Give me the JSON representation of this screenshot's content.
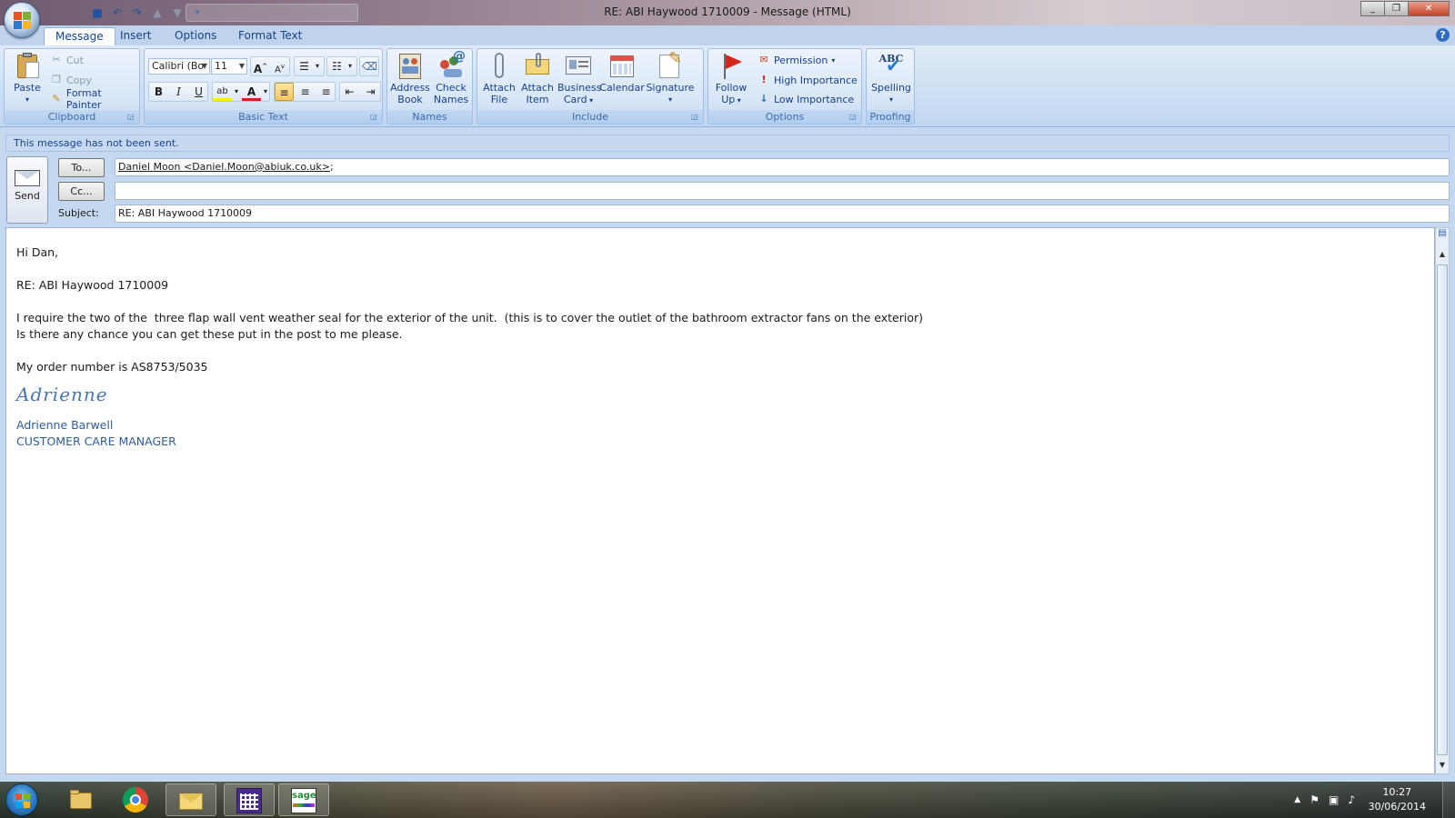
{
  "window": {
    "title": "RE: ABI Haywood 1710009 - Message (HTML)",
    "controls": {
      "minimize": "_",
      "restore": "❐",
      "close": "✕"
    }
  },
  "tabs": [
    {
      "label": "Message",
      "active": true
    },
    {
      "label": "Insert",
      "active": false
    },
    {
      "label": "Options",
      "active": false
    },
    {
      "label": "Format Text",
      "active": false
    }
  ],
  "ribbon": {
    "clipboard": {
      "group_label": "Clipboard",
      "paste": "Paste",
      "cut": "Cut",
      "copy": "Copy",
      "format_painter": "Format Painter"
    },
    "basic_text": {
      "group_label": "Basic Text",
      "font_name": "Calibri (Bo",
      "font_size": "11",
      "bold": "B",
      "italic": "I",
      "underline": "U",
      "font_color_letter": "A"
    },
    "names": {
      "group_label": "Names",
      "address_book_1": "Address",
      "address_book_2": "Book",
      "check_names_1": "Check",
      "check_names_2": "Names"
    },
    "include": {
      "group_label": "Include",
      "attach_file_1": "Attach",
      "attach_file_2": "File",
      "attach_item_1": "Attach",
      "attach_item_2": "Item",
      "business_card_1": "Business",
      "business_card_2": "Card",
      "calendar": "Calendar",
      "signature": "Signature"
    },
    "options": {
      "group_label": "Options",
      "follow_up_1": "Follow",
      "follow_up_2": "Up",
      "permission": "Permission",
      "high_importance": "High Importance",
      "low_importance": "Low Importance"
    },
    "proofing": {
      "group_label": "Proofing",
      "spelling": "Spelling",
      "abc": "ABC"
    }
  },
  "message": {
    "notice": "This message has not been sent.",
    "send_label": "Send",
    "to_button": "To...",
    "cc_button": "Cc...",
    "subject_label": "Subject:",
    "to_value": "Daniel Moon <Daniel.Moon@abiuk.co.uk>",
    "to_separator": ";",
    "cc_value": "",
    "subject_value": "RE: ABI Haywood 1710009"
  },
  "body": {
    "greeting": "Hi Dan,",
    "reference": "RE: ABI Haywood 1710009",
    "line1": "I require the two of the  three flap wall vent weather seal for the exterior of the unit.  (this is to cover the outlet of the bathroom extractor fans on the exterior)",
    "line2": "Is there any chance you can get these put in the post to me please.",
    "order": "My order number is AS8753/5035",
    "signature_script": "Adrienne",
    "signature_name": "Adrienne Barwell",
    "signature_title": "CUSTOMER CARE MANAGER"
  },
  "taskbar": {
    "time": "10:27",
    "date": "30/06/2014",
    "apps": [
      "explorer",
      "chrome",
      "outlook",
      "grid-app",
      "sage"
    ],
    "sage_label": "sage"
  }
}
